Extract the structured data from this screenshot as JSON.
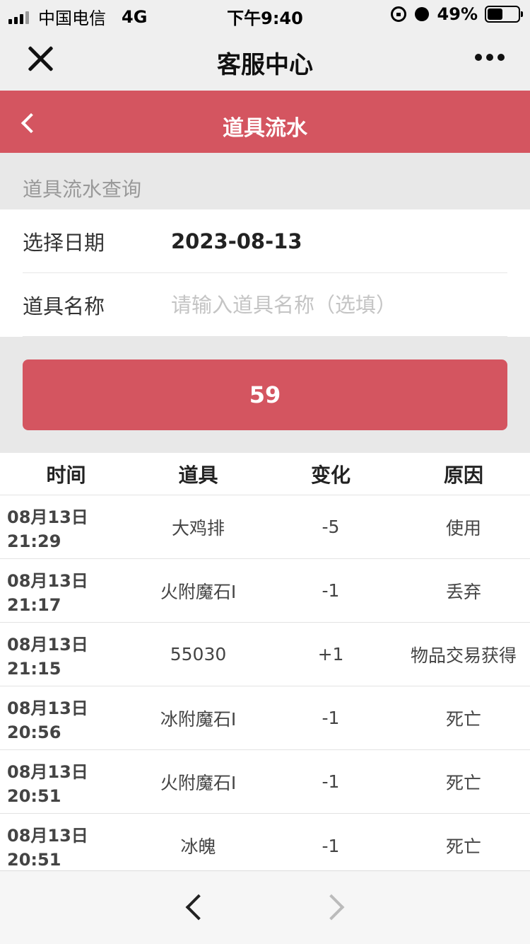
{
  "status_bar": {
    "carrier": "中国电信",
    "network": "4G",
    "time": "下午9:40",
    "battery_percent": "49%",
    "battery_level": 0.49,
    "icons": [
      "signal-icon",
      "orientation-lock-icon",
      "alarm-icon",
      "battery-icon"
    ]
  },
  "nav": {
    "title": "客服中心",
    "close_icon": "close-icon",
    "more_icon": "more-icon"
  },
  "header": {
    "title": "道具流水",
    "back_icon": "chevron-left-icon",
    "color": "#d45560"
  },
  "query": {
    "section_label": "道具流水查询",
    "date_label": "选择日期",
    "date_value": "2023-08-13",
    "name_label": "道具名称",
    "name_placeholder": "请输入道具名称（选填）",
    "name_value": "",
    "button_label": "59"
  },
  "table": {
    "columns": [
      "时间",
      "道具",
      "变化",
      "原因"
    ],
    "rows": [
      {
        "date": "08月13日",
        "time": "21:29",
        "item": "大鸡排",
        "change": "-5",
        "reason": "使用"
      },
      {
        "date": "08月13日",
        "time": "21:17",
        "item": "火附魔石I",
        "change": "-1",
        "reason": "丢弃"
      },
      {
        "date": "08月13日",
        "time": "21:15",
        "item": "55030",
        "change": "+1",
        "reason": "物品交易获得"
      },
      {
        "date": "08月13日",
        "time": "20:56",
        "item": "冰附魔石I",
        "change": "-1",
        "reason": "死亡"
      },
      {
        "date": "08月13日",
        "time": "20:51",
        "item": "火附魔石I",
        "change": "-1",
        "reason": "死亡"
      },
      {
        "date": "08月13日",
        "time": "20:51",
        "item": "冰魄",
        "change": "-1",
        "reason": "死亡"
      }
    ]
  },
  "bottom_bar": {
    "prev_icon": "chevron-left-icon",
    "next_icon": "chevron-right-icon"
  }
}
